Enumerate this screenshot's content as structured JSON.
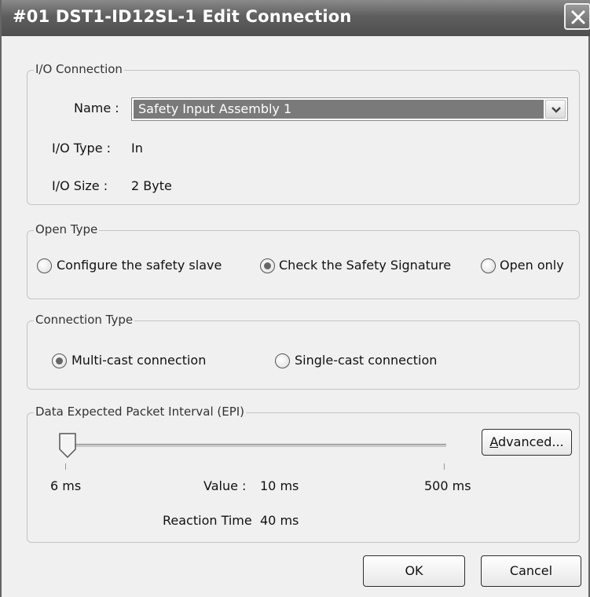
{
  "window": {
    "title": "#01 DST1-ID12SL-1 Edit Connection"
  },
  "io_connection": {
    "legend": "I/O Connection",
    "name_label": "Name :",
    "name_value": "Safety Input Assembly 1",
    "io_type_label": "I/O Type :",
    "io_type_value": "In",
    "io_size_label": "I/O Size :",
    "io_size_value": "2 Byte"
  },
  "open_type": {
    "legend": "Open Type",
    "options": [
      {
        "label": "Configure the safety slave",
        "selected": false
      },
      {
        "label": "Check the Safety Signature",
        "selected": true
      },
      {
        "label": "Open only",
        "selected": false
      }
    ]
  },
  "connection_type": {
    "legend": "Connection Type",
    "options": [
      {
        "label": "Multi-cast connection",
        "selected": true
      },
      {
        "label": "Single-cast connection",
        "selected": false
      }
    ]
  },
  "epi": {
    "legend": "Data Expected Packet Interval (EPI)",
    "min_label": "6 ms",
    "max_label": "500 ms",
    "value_label": "Value :",
    "value": "10 ms",
    "reaction_label": "Reaction Time",
    "reaction_value": "40 ms",
    "slider_value_ms": 10,
    "advanced_accel": "A",
    "advanced_rest": "dvanced..."
  },
  "buttons": {
    "ok": "OK",
    "cancel": "Cancel"
  },
  "colors": {
    "titlebar": "#5e5e5e",
    "selection": "#7a7a7a",
    "dialog_bg": "#f0f0f0"
  }
}
